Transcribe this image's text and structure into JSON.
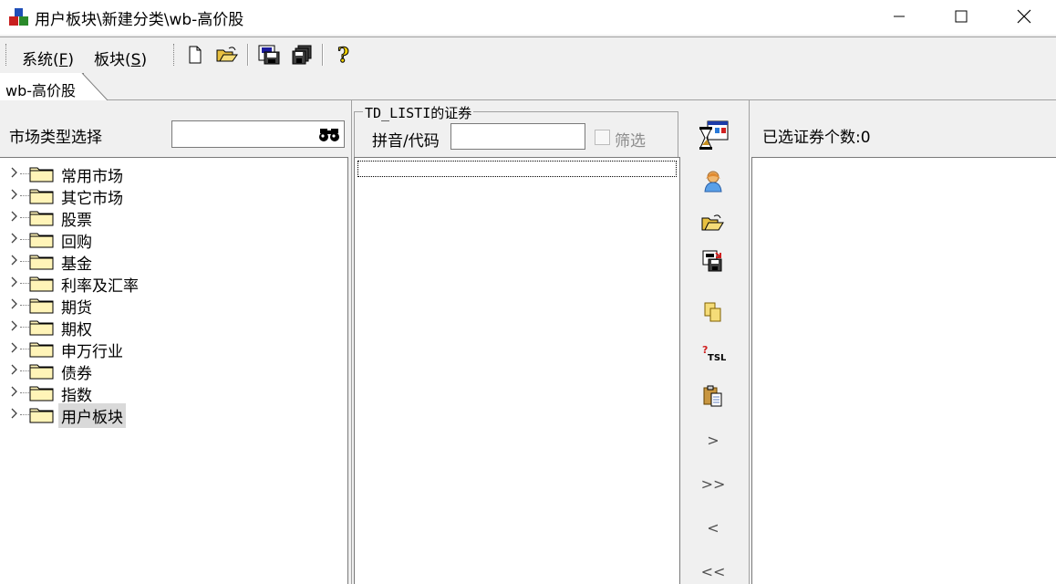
{
  "window": {
    "title": "用户板块\\新建分类\\wb-高价股",
    "icon": "app-cubes-icon",
    "controls": [
      "minimize",
      "maximize",
      "close"
    ]
  },
  "menu": {
    "system": "系统(",
    "system_key": "F",
    "system_end": ")",
    "plate": "板块(",
    "plate_key": "S",
    "plate_end": ")"
  },
  "toolbar": {
    "buttons": [
      "new-file-icon",
      "open-folder-icon",
      "save-icon",
      "save-all-icon",
      "help-icon"
    ]
  },
  "tabs": [
    {
      "label": "wb-高价股",
      "active": true
    }
  ],
  "left": {
    "label": "市场类型选择",
    "search_value": "",
    "tree": [
      {
        "label": "常用市场",
        "selected": false
      },
      {
        "label": "其它市场",
        "selected": false
      },
      {
        "label": "股票",
        "selected": false
      },
      {
        "label": "回购",
        "selected": false
      },
      {
        "label": "基金",
        "selected": false
      },
      {
        "label": "利率及汇率",
        "selected": false
      },
      {
        "label": "期货",
        "selected": false
      },
      {
        "label": "期权",
        "selected": false
      },
      {
        "label": "申万行业",
        "selected": false
      },
      {
        "label": "债券",
        "selected": false
      },
      {
        "label": "指数",
        "selected": false
      },
      {
        "label": "用户板块",
        "selected": true
      }
    ]
  },
  "middle": {
    "group_title": "TD_LISTI的证券",
    "pinyin_label": "拼音/代码",
    "pinyin_value": "",
    "filter_label": "筛选",
    "filter_checked": false
  },
  "actions": {
    "add_one": ">",
    "add_all": ">>",
    "remove_one": "<",
    "remove_all": "<<"
  },
  "right": {
    "selected_count_label": "已选证券个数:0"
  }
}
